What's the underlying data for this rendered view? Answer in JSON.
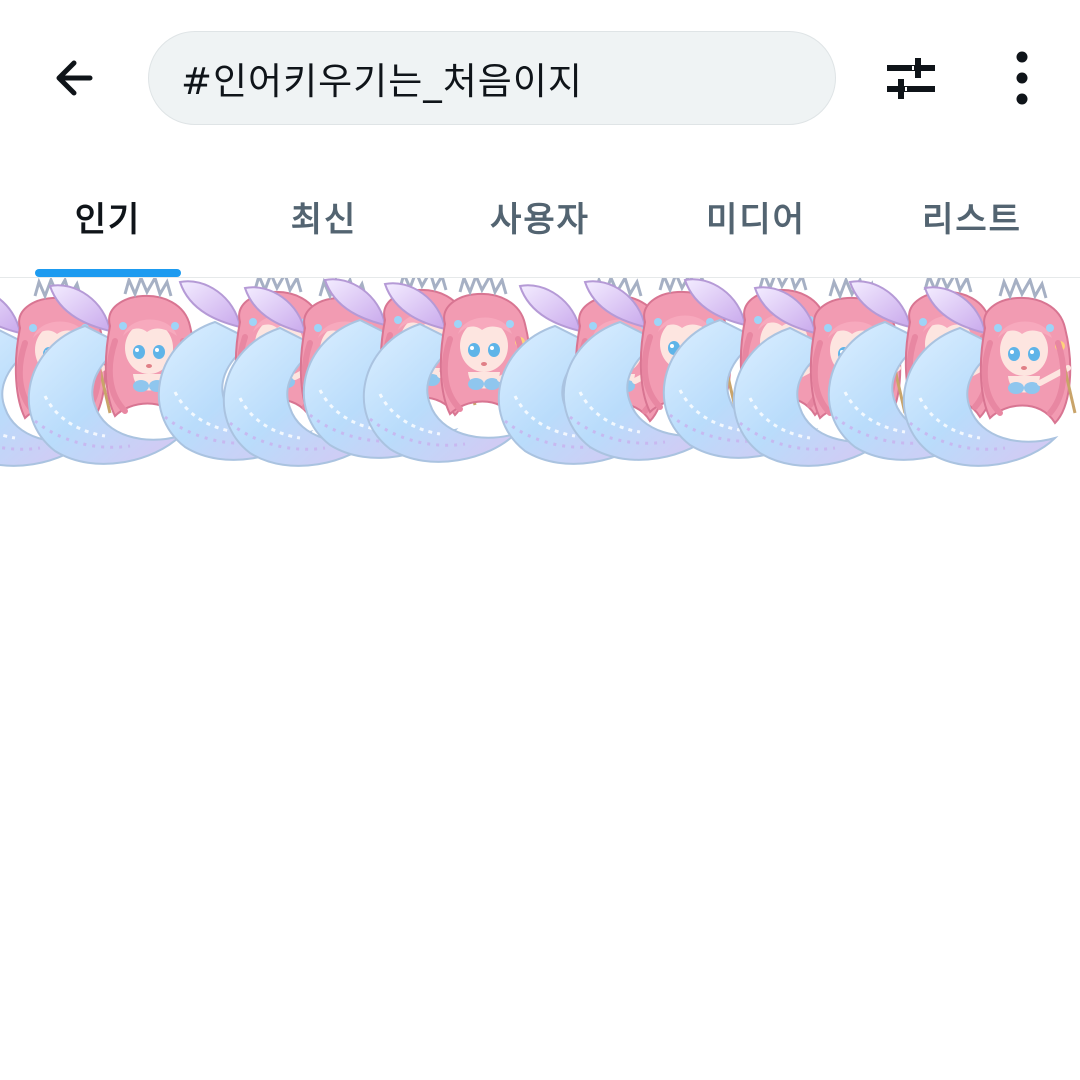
{
  "header": {
    "search_query": "#인어키우기는_처음이지"
  },
  "tabs": [
    {
      "label": "인기",
      "active": true
    },
    {
      "label": "최신",
      "active": false
    },
    {
      "label": "사용자",
      "active": false
    },
    {
      "label": "미디어",
      "active": false
    },
    {
      "label": "리스트",
      "active": false
    }
  ],
  "icons": {
    "back": "arrow-left-icon",
    "filter": "sliders-icon",
    "more": "more-vertical-icon"
  },
  "colors": {
    "accent": "#1d9bf0",
    "text_primary": "#0f1419",
    "text_secondary": "#536471",
    "search_bg": "#eff3f4"
  },
  "media": {
    "subject": "pixel-art pink-haired mermaid characters",
    "count_visible": 8
  }
}
